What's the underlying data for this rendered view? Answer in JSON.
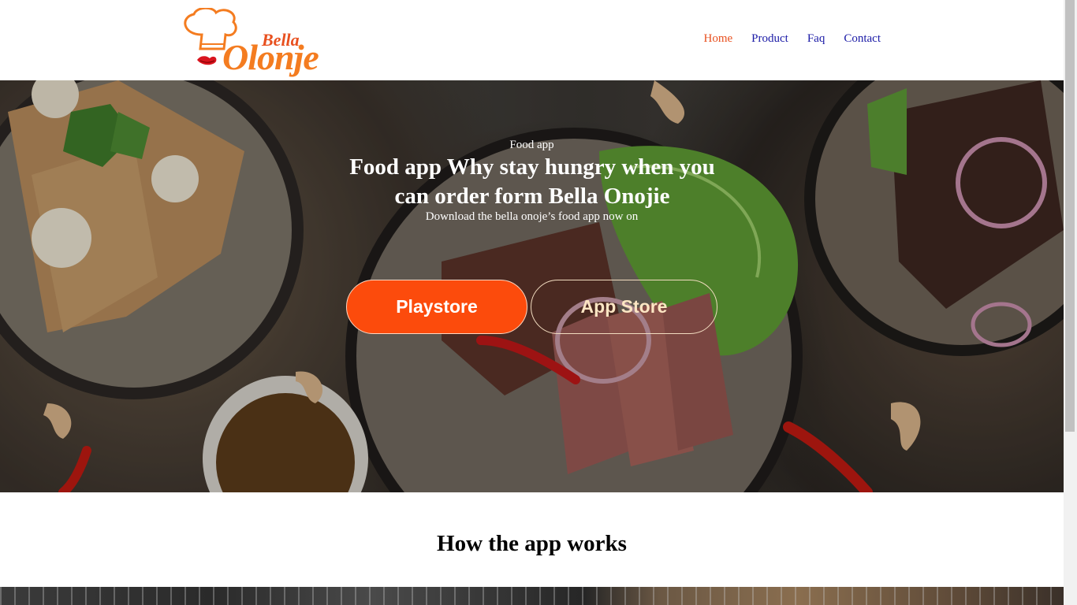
{
  "header": {
    "logo": {
      "line1": "Bella",
      "line2": "Olonje"
    },
    "nav": [
      {
        "label": "Home",
        "active": true
      },
      {
        "label": "Product",
        "active": false
      },
      {
        "label": "Faq",
        "active": false
      },
      {
        "label": "Contact",
        "active": false
      }
    ]
  },
  "hero": {
    "eyebrow": "Food app",
    "title": "Food app Why stay hungry when you can order form Bella Onojie",
    "subtitle": "Download the bella onoje’s food app now on",
    "buttons": {
      "playstore": "Playstore",
      "appstore": "App Store"
    }
  },
  "section": {
    "title": "How the app works"
  },
  "colors": {
    "accent": "#fc4b0c",
    "nav_active": "#e8501f",
    "nav_link": "#1a1aa6",
    "logo_orange": "#f47c20"
  }
}
